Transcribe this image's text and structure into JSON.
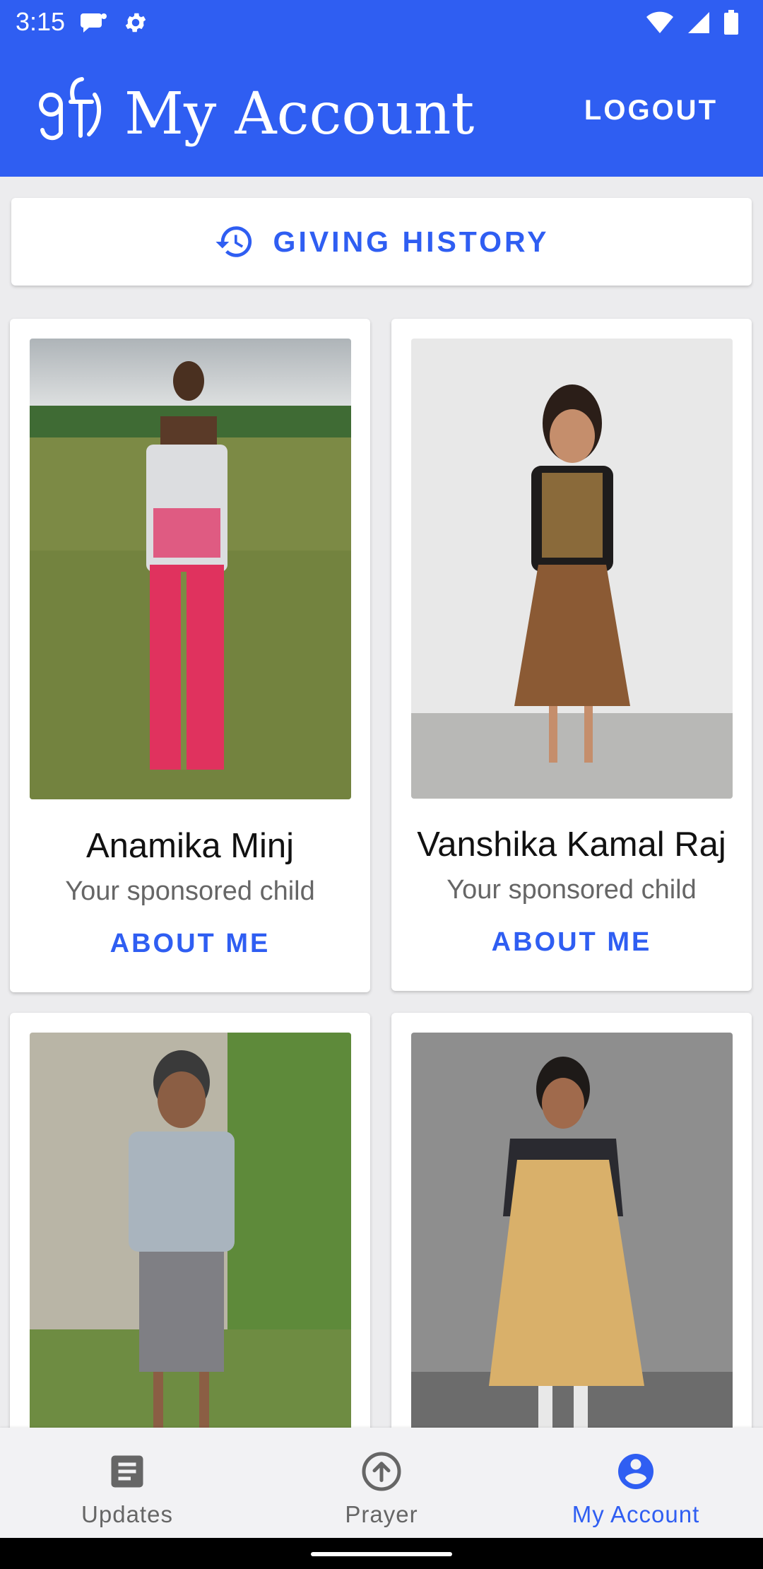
{
  "status_bar": {
    "time": "3:15"
  },
  "app_bar": {
    "title": "My Account",
    "logout_label": "LOGOUT"
  },
  "giving_history": {
    "label": "GIVING HISTORY",
    "icon": "history-icon"
  },
  "children": [
    {
      "name": "Anamika Minj",
      "subtitle": "Your sponsored child",
      "action": "ABOUT ME"
    },
    {
      "name": "Vanshika Kamal Raj",
      "subtitle": "Your sponsored child",
      "action": "ABOUT ME"
    },
    {
      "name": "",
      "subtitle": "",
      "action": ""
    },
    {
      "name": "",
      "subtitle": "",
      "action": ""
    }
  ],
  "bottom_nav": {
    "items": [
      {
        "label": "Updates",
        "icon": "article-icon",
        "active": false
      },
      {
        "label": "Prayer",
        "icon": "arrow-up-circle-icon",
        "active": false
      },
      {
        "label": "My Account",
        "icon": "account-circle-icon",
        "active": true
      }
    ]
  },
  "colors": {
    "primary": "#2F5EF2",
    "background": "#ECECEE",
    "card": "#FFFFFF",
    "inactive_nav": "#666666"
  }
}
